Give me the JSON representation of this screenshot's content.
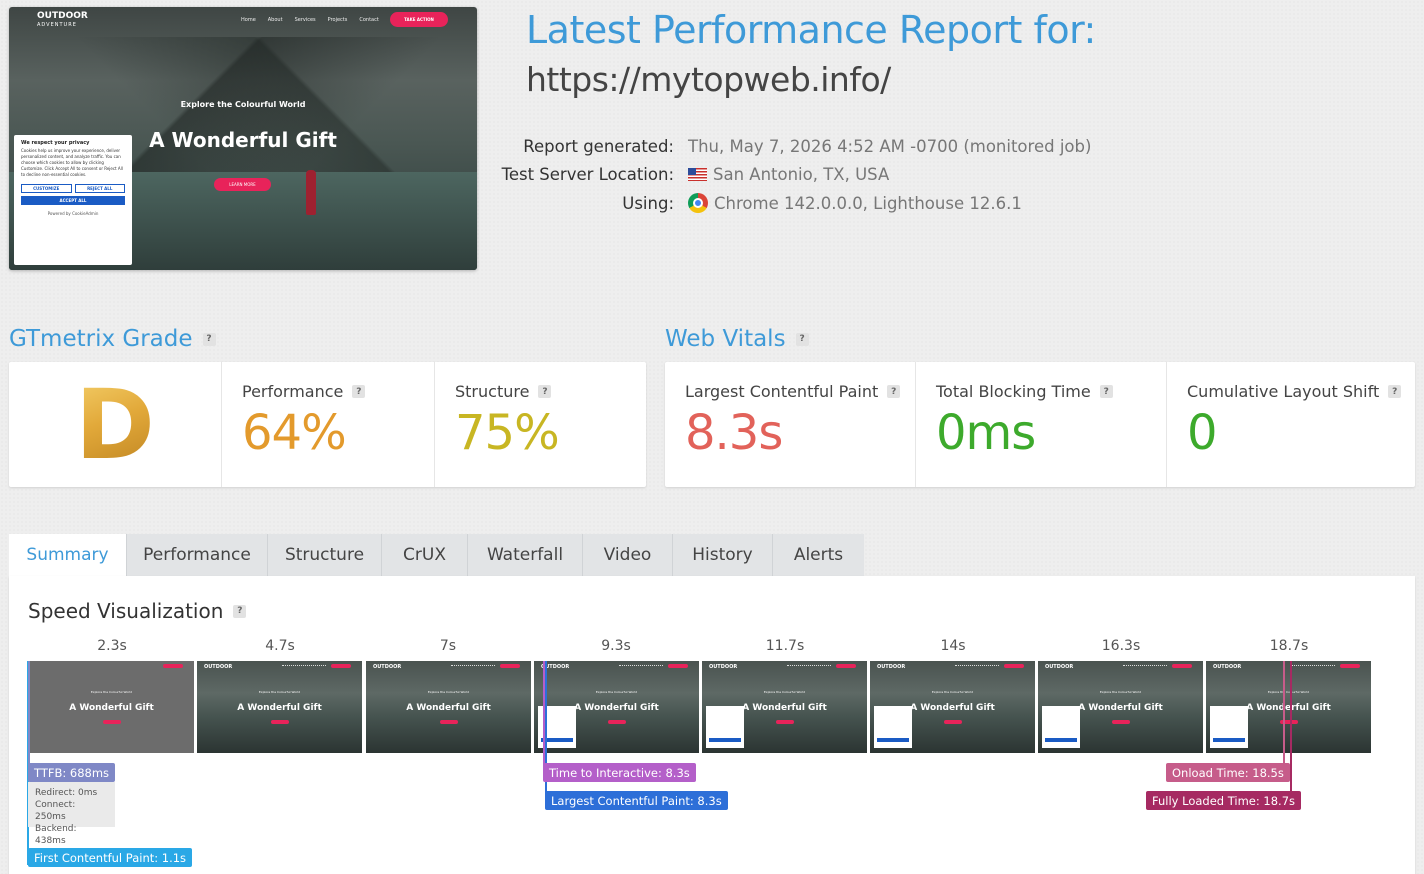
{
  "thumbnail": {
    "logo": "OUTDOOR",
    "logo_sub": "ADVENTURE",
    "nav": [
      "Home",
      "About",
      "Services",
      "Projects",
      "Contact"
    ],
    "cta": "TAKE ACTION",
    "kicker": "Explore the Colourful World",
    "hero": "A Wonderful Gift",
    "learn": "LEARN MORE",
    "cookie": {
      "title": "We respect your privacy",
      "body": "Cookies help us improve your experience, deliver personalized content, and analyze traffic. You can choose which cookies to allow by clicking Customize. Click Accept All to consent or Reject All to decline non-essential cookies.",
      "customize": "CUSTOMIZE",
      "reject": "REJECT ALL",
      "accept": "ACCEPT ALL",
      "powered": "Powered by CookieAdmin"
    }
  },
  "report": {
    "title": "Latest Performance Report for:",
    "url": "https://mytopweb.info/",
    "generated_label": "Report generated:",
    "generated_value": "Thu, May 7, 2026 4:52 AM -0700 (monitored job)",
    "location_label": "Test Server Location:",
    "location_value": "San Antonio, TX, USA",
    "using_label": "Using:",
    "using_value": "Chrome 142.0.0.0, Lighthouse 12.6.1"
  },
  "grade": {
    "heading": "GTmetrix Grade",
    "letter": "D",
    "performance_label": "Performance",
    "performance_value": "64%",
    "structure_label": "Structure",
    "structure_value": "75%"
  },
  "vitals": {
    "heading": "Web Vitals",
    "lcp_label": "Largest Contentful Paint",
    "lcp_value": "8.3s",
    "tbt_label": "Total Blocking Time",
    "tbt_value": "0ms",
    "cls_label": "Cumulative Layout Shift",
    "cls_value": "0"
  },
  "colors": {
    "accent": "#3e9ad8",
    "grade_gold": "#e2a93a",
    "perf": "#e39a2c",
    "structure": "#c8b623",
    "lcp": "#e2625a",
    "good": "#3daa2c"
  },
  "tabs": [
    "Summary",
    "Performance",
    "Structure",
    "CrUX",
    "Waterfall",
    "Video",
    "History",
    "Alerts"
  ],
  "speed": {
    "heading": "Speed Visualization",
    "times": [
      "2.3s",
      "4.7s",
      "7s",
      "9.3s",
      "11.7s",
      "14s",
      "16.3s",
      "18.7s"
    ],
    "frame_title": "A Wonderful Gift",
    "frame_kicker": "Explore the Colourful World",
    "frame_logo": "OUTDOOR",
    "ttfb": "TTFB: 688ms",
    "redirect": "Redirect: 0ms",
    "connect": "Connect: 250ms",
    "backend": "Backend: 438ms",
    "fcp": "First Contentful Paint: 1.1s",
    "tti": "Time to Interactive: 8.3s",
    "lcp": "Largest Contentful Paint: 8.3s",
    "onload": "Onload Time: 18.5s",
    "fully": "Fully Loaded Time: 18.7s"
  }
}
